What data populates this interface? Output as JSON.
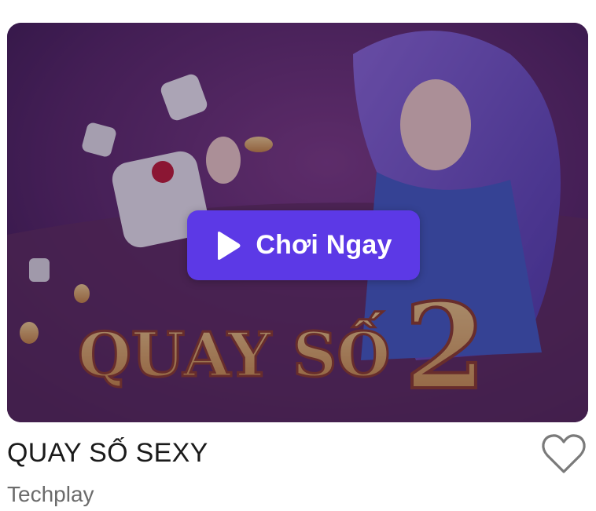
{
  "game": {
    "title": "QUAY SỐ SEXY",
    "provider": "Techplay",
    "artwork_text": "QUAY SỐ",
    "artwork_number": "2"
  },
  "play_button": {
    "label": "Chơi Ngay",
    "icon": "play-icon",
    "color": "#5c39e6"
  },
  "favorite": {
    "icon": "heart-outline-icon"
  }
}
